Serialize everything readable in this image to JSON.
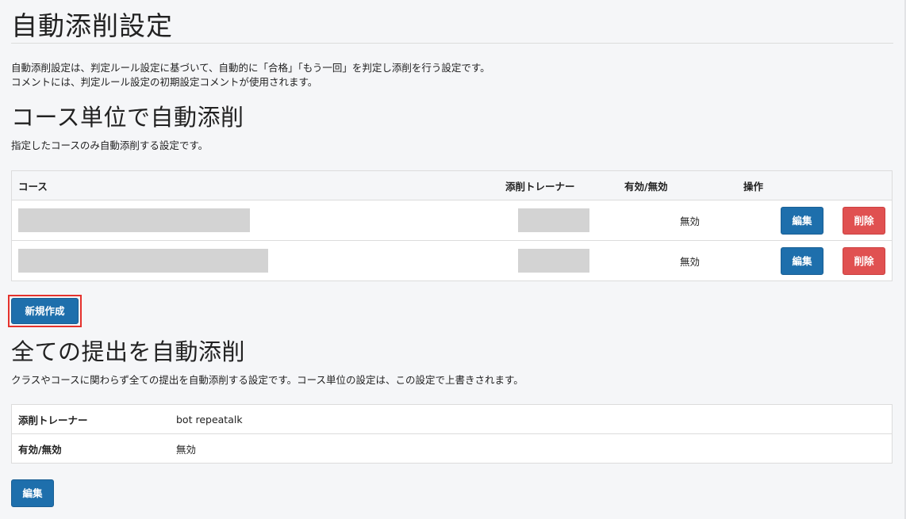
{
  "page": {
    "title": "自動添削設定",
    "intro_line1": "自動添削設定は、判定ルール設定に基づいて、自動的に「合格」「もう一回」を判定し添削を行う設定です。",
    "intro_line2": "コメントには、判定ルール設定の初期設定コメントが使用されます。"
  },
  "course_section": {
    "heading": "コース単位で自動添削",
    "description": "指定したコースのみ自動添削する設定です。",
    "columns": {
      "course": "コース",
      "trainer": "添削トレーナー",
      "status": "有効/無効",
      "ops": "操作"
    },
    "rows": [
      {
        "status": "無効",
        "edit": "編集",
        "delete": "削除"
      },
      {
        "status": "無効",
        "edit": "編集",
        "delete": "削除"
      }
    ],
    "new_button": "新規作成"
  },
  "all_section": {
    "heading": "全ての提出を自動添削",
    "description": "クラスやコースに関わらず全ての提出を自動添削する設定です。コース単位の設定は、この設定で上書きされます。",
    "trainer_label": "添削トレーナー",
    "trainer_value": "bot repeatalk",
    "status_label": "有効/無効",
    "status_value": "無効",
    "edit_button": "編集"
  },
  "colors": {
    "primary": "#1e6fac",
    "danger": "#e05151",
    "highlight": "#e5322d",
    "redacted": "#d3d3d3"
  }
}
